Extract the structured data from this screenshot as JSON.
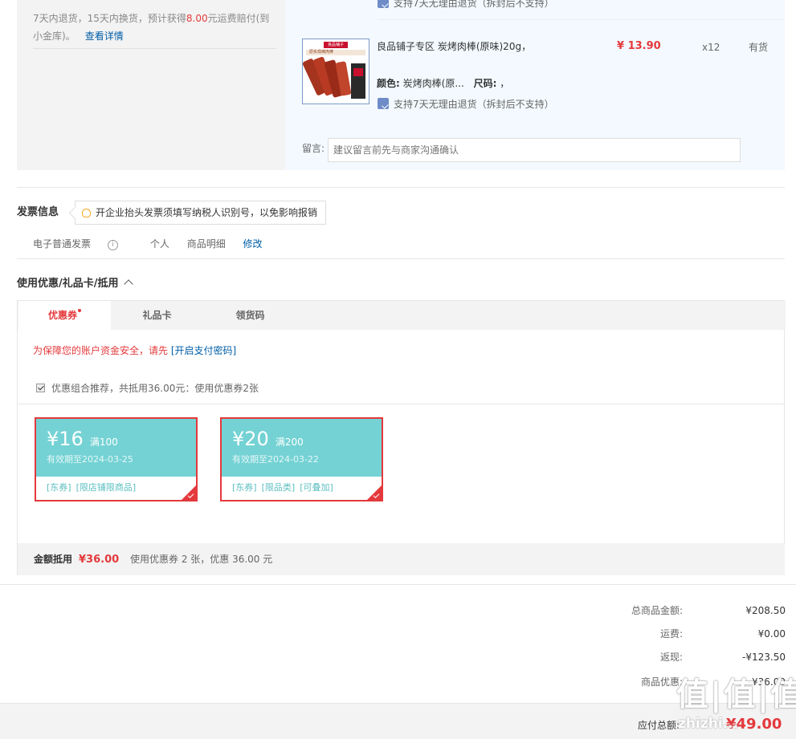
{
  "order": {
    "policy_prefix": "7天内退货，15天内换货，预计获得",
    "policy_highlight": "8.00",
    "policy_suffix": "元运费赔付(到小金库)。",
    "policy_link": "查看详情",
    "return_tag_top": "支持7天无理由退货（拆封后不支持）",
    "product_name": "良品铺子专区 炭烤肉棒(原味)20g，",
    "price": "¥ 13.90",
    "qty": "x12",
    "stock": "有货",
    "color_label": "颜色:",
    "color_value": "炭烤肉棒(原...",
    "size_label": "尺码:",
    "size_value": "，",
    "return_tag": "支持7天无理由退货（拆封后不支持）",
    "thumb_brand": "良品铺子",
    "thumb_caption": "原实现烤肉棒",
    "message_label": "留言:",
    "message_placeholder": "建议留言前先与商家沟通确认"
  },
  "invoice": {
    "title": "发票信息",
    "tip": "开企业抬头发票须填写纳税人识别号，以免影响报销",
    "type": "电子普通发票",
    "info_glyph": "i",
    "holder": "个人",
    "content": "商品明细",
    "modify": "修改"
  },
  "coupon": {
    "title": "使用优惠/礼品卡/抵用",
    "tabs": [
      {
        "label": "优惠券"
      },
      {
        "label": "礼品卡"
      },
      {
        "label": "领货码"
      }
    ],
    "warning": "为保障您的账户资金安全，请先",
    "warning_link": "[开启支付密码]",
    "recommend": "优惠组合推荐，共抵用36.00元：使用优惠券2张",
    "cards": [
      {
        "amount": "¥16",
        "condition": "满100",
        "expiry": "有效期至2024-03-25",
        "tags": [
          "[东券]",
          "[限店铺限商品]"
        ]
      },
      {
        "amount": "¥20",
        "condition": "满200",
        "expiry": "有效期至2024-03-22",
        "tags": [
          "[东券]",
          "[限品类]",
          "[可叠加]"
        ]
      }
    ],
    "summary_label": "金额抵用",
    "summary_amount": "¥36.00",
    "summary_desc": "使用优惠券 2 张，优惠 36.00 元"
  },
  "totals": {
    "rows": [
      {
        "label": "总商品金额:",
        "value": "¥208.50"
      },
      {
        "label": "运费:",
        "value": "¥0.00"
      },
      {
        "label": "返现:",
        "value": "-¥123.50"
      },
      {
        "label": "商品优惠:",
        "value": "-¥36.00"
      }
    ],
    "pay_label": "应付总额:",
    "pay_amount": "¥49.00"
  },
  "watermark": {
    "logo": "值|值|值",
    "site": "zhizhi..."
  },
  "colors": {
    "accent": "#e4393c",
    "link": "#005ea7",
    "coupon": "#74d2d4"
  }
}
